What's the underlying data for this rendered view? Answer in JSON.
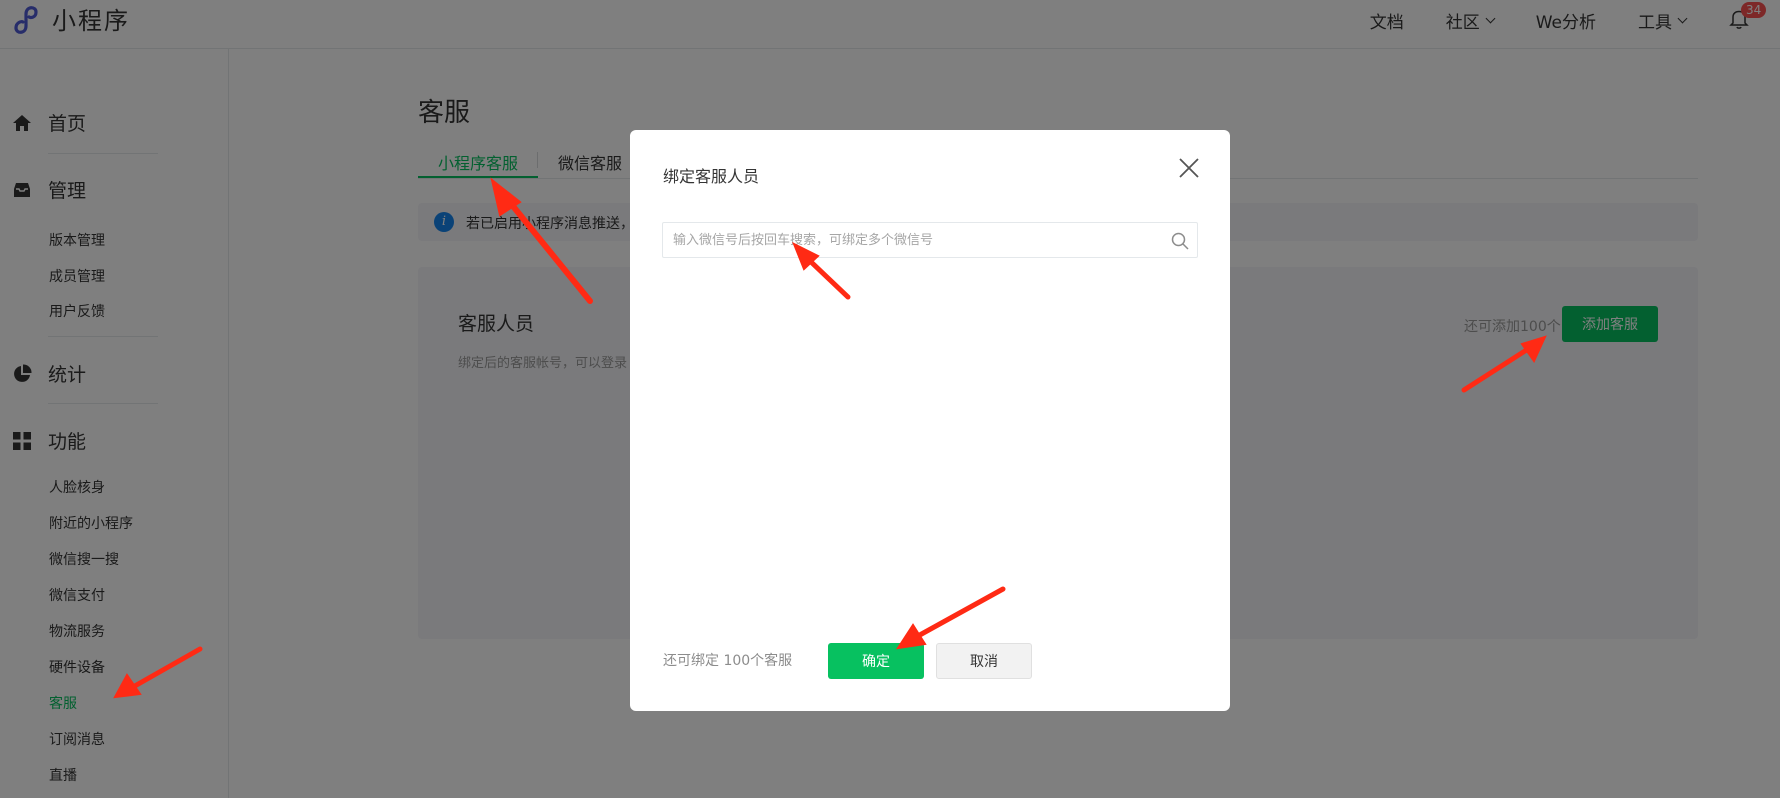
{
  "colors": {
    "brand": "#07c160",
    "accent_blue": "#1485ee",
    "badge": "#fa5151",
    "annotation": "#ff2a14"
  },
  "header": {
    "logo_text": "小程序",
    "nav": [
      {
        "label": "文档",
        "dropdown": false
      },
      {
        "label": "社区",
        "dropdown": true
      },
      {
        "label": "We分析",
        "dropdown": false
      },
      {
        "label": "工具",
        "dropdown": true
      }
    ],
    "notification_count": "34",
    "icons": {
      "logo": "miniprogram-logo-icon",
      "bell": "bell-icon"
    }
  },
  "sidebar": {
    "sections": [
      {
        "label": "首页",
        "icon": "home-icon"
      },
      {
        "label": "管理",
        "icon": "inbox-icon",
        "items": [
          "版本管理",
          "成员管理",
          "用户反馈"
        ]
      },
      {
        "label": "统计",
        "icon": "pie-chart-icon"
      },
      {
        "label": "功能",
        "icon": "grid-icon",
        "items": [
          "人脸核身",
          "附近的小程序",
          "微信搜一搜",
          "微信支付",
          "物流服务",
          "硬件设备",
          "客服",
          "订阅消息",
          "直播"
        ]
      }
    ],
    "active_item": "客服"
  },
  "main": {
    "title": "客服",
    "tabs": [
      {
        "label": "小程序客服",
        "active": true
      },
      {
        "label": "微信客服",
        "active": false
      }
    ],
    "notice": "若已启用小程序消息推送，",
    "card": {
      "title": "客服人员",
      "description": "绑定后的客服帐号，可以登录",
      "remaining": "还可添加100个",
      "add_button": "添加客服"
    }
  },
  "dialog": {
    "title": "绑定客服人员",
    "search_placeholder": "输入微信号后按回车搜索，可绑定多个微信号",
    "search_value": "",
    "remaining": "还可绑定 100个客服",
    "confirm_label": "确定",
    "cancel_label": "取消",
    "icons": {
      "close": "close-icon",
      "search": "search-icon"
    }
  }
}
